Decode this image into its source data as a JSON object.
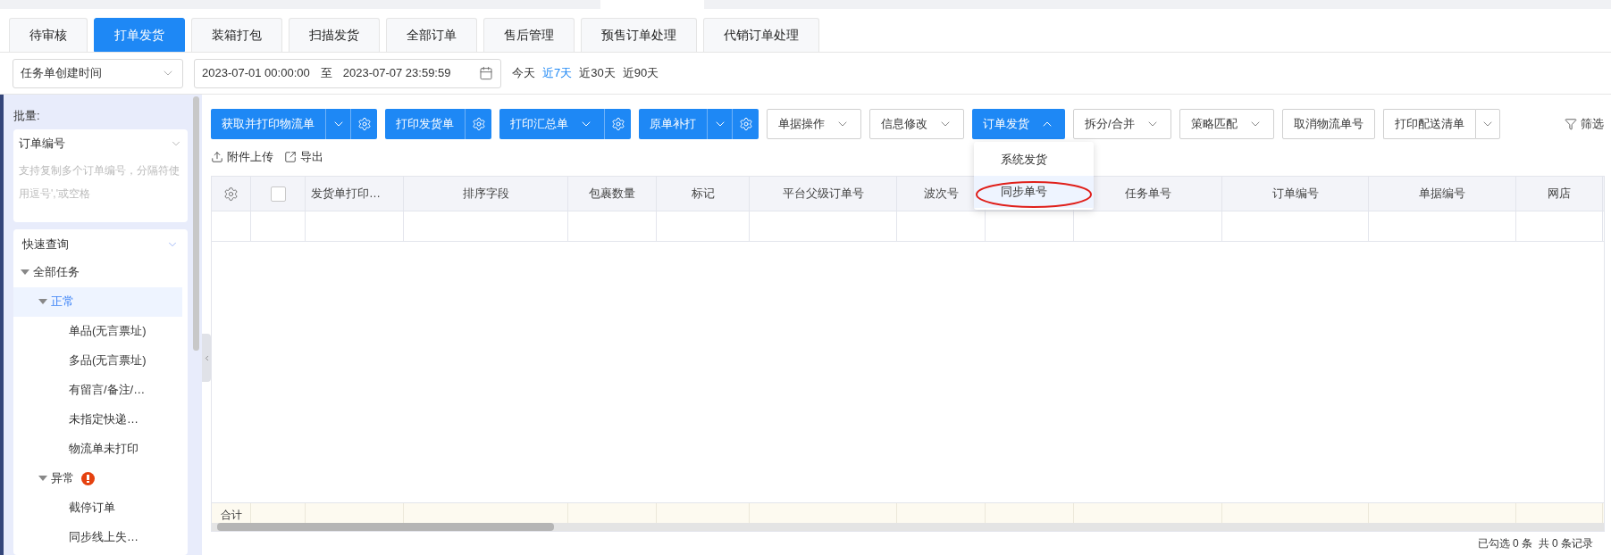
{
  "tabs": [
    {
      "label": "待审核",
      "selected": false
    },
    {
      "label": "打单发货",
      "selected": true
    },
    {
      "label": "装箱打包",
      "selected": false
    },
    {
      "label": "扫描发货",
      "selected": false
    },
    {
      "label": "全部订单",
      "selected": false
    },
    {
      "label": "售后管理",
      "selected": false
    },
    {
      "label": "预售订单处理",
      "selected": false
    },
    {
      "label": "代销订单处理",
      "selected": false
    }
  ],
  "filter": {
    "time_field": "任务单创建时间",
    "start": "2023-07-01 00:00:00",
    "separator": "至",
    "end": "2023-07-07 23:59:59",
    "quick_ranges": [
      {
        "label": "今天",
        "selected": false
      },
      {
        "label": "近7天",
        "selected": true
      },
      {
        "label": "近30天",
        "selected": false
      },
      {
        "label": "近90天",
        "selected": false
      }
    ]
  },
  "sidebar": {
    "batch_label": "批量:",
    "batch_field": {
      "label": "订单编号",
      "placeholder": "支持复制多个订单编号，分隔符使用逗号','或空格"
    },
    "quick": {
      "title": "快速查询",
      "expanded": true,
      "items": [
        {
          "label": "全部任务",
          "expanded": true,
          "selected": false,
          "alert": false,
          "children": [
            {
              "label": "正常",
              "expanded": true,
              "selected": true,
              "alert": false,
              "children": [
                {
                  "label": "单品(无言票址)",
                  "selected": false
                },
                {
                  "label": "多品(无言票址)",
                  "selected": false
                },
                {
                  "label": "有留言/备注/…",
                  "selected": false
                },
                {
                  "label": "未指定快递…",
                  "selected": false
                },
                {
                  "label": "物流单未打印",
                  "selected": false
                }
              ]
            },
            {
              "label": "异常",
              "expanded": true,
              "selected": false,
              "alert": true,
              "children": [
                {
                  "label": "截停订单",
                  "selected": false
                },
                {
                  "label": "同步线上失…",
                  "selected": false
                }
              ]
            }
          ]
        }
      ]
    }
  },
  "toolbar": {
    "buttons": [
      {
        "label": "获取并打印物流单",
        "kind": "primary",
        "has_menu": true,
        "split": true,
        "open": false,
        "gear": true
      },
      {
        "label": "打印发货单",
        "kind": "primary",
        "has_menu": false,
        "gear": true
      },
      {
        "label": "打印汇总单",
        "kind": "primary",
        "has_menu": true,
        "split": false,
        "open": false,
        "gear": true
      },
      {
        "label": "原单补打",
        "kind": "primary",
        "has_menu": true,
        "split": true,
        "open": false,
        "gear": true
      },
      {
        "label": "单据操作",
        "kind": "outline",
        "has_menu": true,
        "split": false,
        "open": false,
        "gear": false
      },
      {
        "label": "信息修改",
        "kind": "outline",
        "has_menu": true,
        "split": false,
        "open": false,
        "gear": false
      },
      {
        "label": "订单发货",
        "kind": "primary",
        "has_menu": true,
        "split": false,
        "open": true,
        "gear": false
      },
      {
        "label": "拆分/合并",
        "kind": "outline",
        "has_menu": true,
        "split": false,
        "open": false,
        "gear": false
      },
      {
        "label": "策略匹配",
        "kind": "outline",
        "has_menu": true,
        "split": false,
        "open": false,
        "gear": false
      },
      {
        "label": "取消物流单号",
        "kind": "outline",
        "has_menu": false,
        "gear": false
      },
      {
        "label": "打印配送清单",
        "kind": "outline",
        "has_menu": true,
        "split": true,
        "open": false,
        "gear": false
      }
    ],
    "filter_button": "筛选",
    "actions": [
      {
        "label": "附件上传",
        "kind": "upload"
      },
      {
        "label": "导出",
        "kind": "export"
      }
    ]
  },
  "dropdown": {
    "items": [
      {
        "label": "系统发货",
        "selected": false
      },
      {
        "label": "同步单号",
        "selected": true
      }
    ]
  },
  "table": {
    "select_all_checked": false,
    "columns": [
      "发货单打印…",
      "排序字段",
      "包裹数量",
      "标记",
      "平台父级订单号",
      "波次号",
      null,
      "任务单号",
      "订单编号",
      "单据编号",
      "网店"
    ],
    "total_label": "合计"
  },
  "status_bar": "已勾选 0 条  共 0 条记录"
}
